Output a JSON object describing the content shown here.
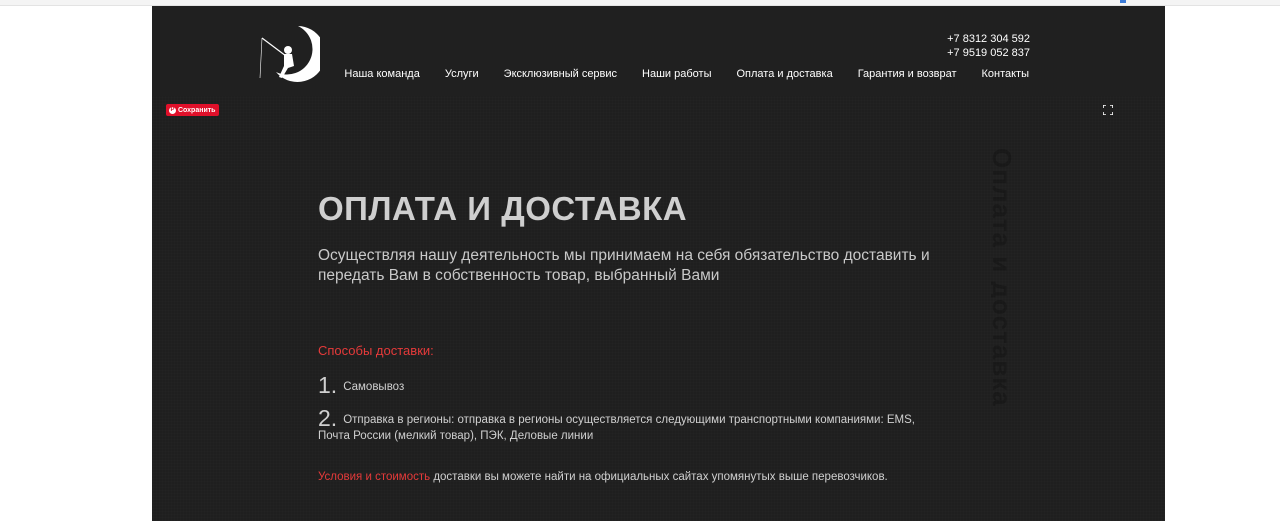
{
  "header": {
    "phones": [
      "+7 8312 304 592",
      "+7 9519 052 837"
    ],
    "nav": [
      "Наша команда",
      "Услуги",
      "Эксклюзивный сервис",
      "Наши работы",
      "Оплата и доставка",
      "Гарантия и возврат",
      "Контакты"
    ]
  },
  "hero": {
    "save_label": "Сохранить",
    "watermark": "Оплата и доставка",
    "title": "ОПЛАТА И ДОСТАВКА",
    "subtitle": "Осуществляя нашу деятельность мы принимаем на себя обязательство доставить и передать Вам в собственность товар, выбранный Вами",
    "delivery_title": "Способы доставки:",
    "items": [
      {
        "num": "1.",
        "text": "Самовывоз"
      },
      {
        "num": "2.",
        "text": "Отправка в регионы: отправка в регионы осуществляется следующими транспортными компаниями: EMS, Почта России (мелкий товар), ПЭК, Деловые линии"
      }
    ],
    "conditions_link": "Условия и стоимость",
    "conditions_rest": " доставки вы можете найти на официальных сайтах упомянутых выше перевозчиков."
  },
  "colors": {
    "accent": "#e53a3a",
    "background": "#1f1f1f",
    "pinterest": "#e0102a"
  }
}
